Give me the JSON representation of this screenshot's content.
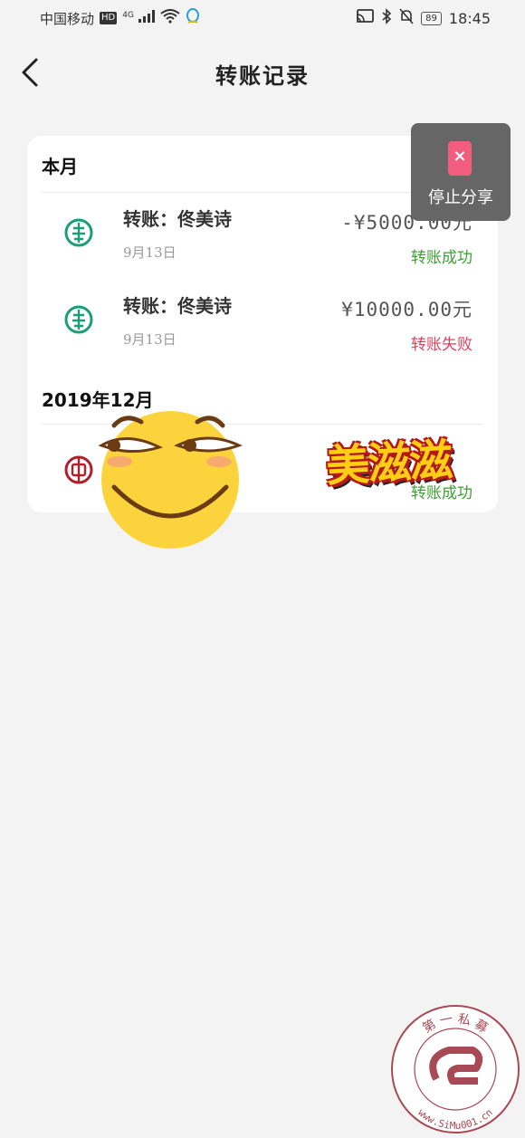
{
  "status_bar": {
    "carrier": "中国移动",
    "hd": "HD",
    "network": "4G",
    "battery": "89",
    "time": "18:45"
  },
  "header": {
    "title": "转账记录"
  },
  "sections": [
    {
      "title": "本月",
      "records": [
        {
          "name": "转账：佟美诗",
          "date": "9月13日",
          "amount": "-¥5000.00元",
          "status": "转账成功",
          "status_type": "success",
          "bank_icon": "abc-bank-icon"
        },
        {
          "name": "转账：佟美诗",
          "date": "9月13日",
          "amount": "¥10000.00元",
          "status": "转账失败",
          "status_type": "fail",
          "bank_icon": "abc-bank-icon"
        }
      ]
    },
    {
      "title": "2019年12月",
      "records": [
        {
          "status": "转账成功",
          "status_type": "success",
          "bank_icon": "boc-bank-icon"
        }
      ]
    }
  ],
  "overlay": {
    "stop_share_label": "停止分享"
  },
  "stickers": {
    "text": "美滋滋"
  },
  "watermark": {
    "top_text": "第 一 私 募",
    "url_text": "www.SiMu001.cn"
  },
  "colors": {
    "success": "#3e9f34",
    "fail": "#e0405f",
    "abc_green": "#1b9e77",
    "boc_red": "#b01e2a"
  }
}
